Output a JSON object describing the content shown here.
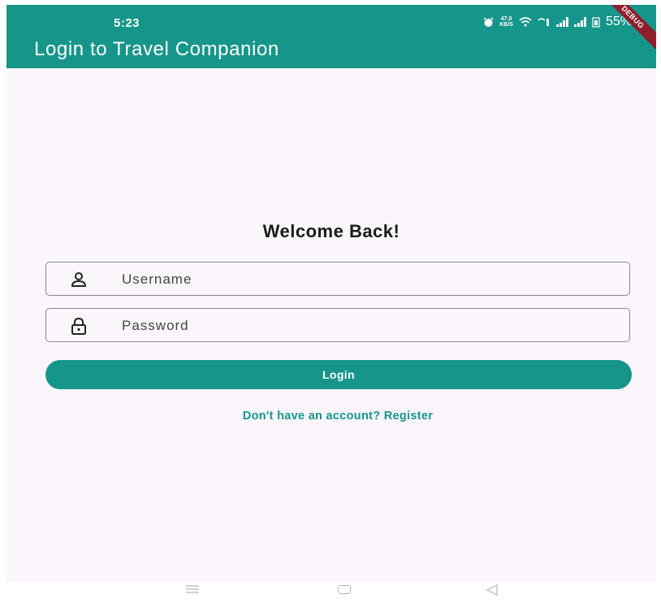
{
  "status_bar": {
    "time": "5:23",
    "net_speed_value": "47.0",
    "net_speed_unit": "KB/S",
    "battery_percent": "55%"
  },
  "debug_banner": "DEBUG",
  "app_bar": {
    "title": "Login to Travel Companion"
  },
  "form": {
    "heading": "Welcome Back!",
    "username_placeholder": "Username",
    "password_placeholder": "Password",
    "login_label": "Login",
    "register_link": "Don't have an account? Register"
  },
  "colors": {
    "primary": "#16968a",
    "background": "#fbf6fc",
    "debug_ribbon": "#8e1e2b"
  },
  "icons": {
    "username": "person-icon",
    "password": "lock-icon",
    "nav_menu": "menu-icon",
    "nav_home": "home-square-icon",
    "nav_back": "back-triangle-icon"
  }
}
